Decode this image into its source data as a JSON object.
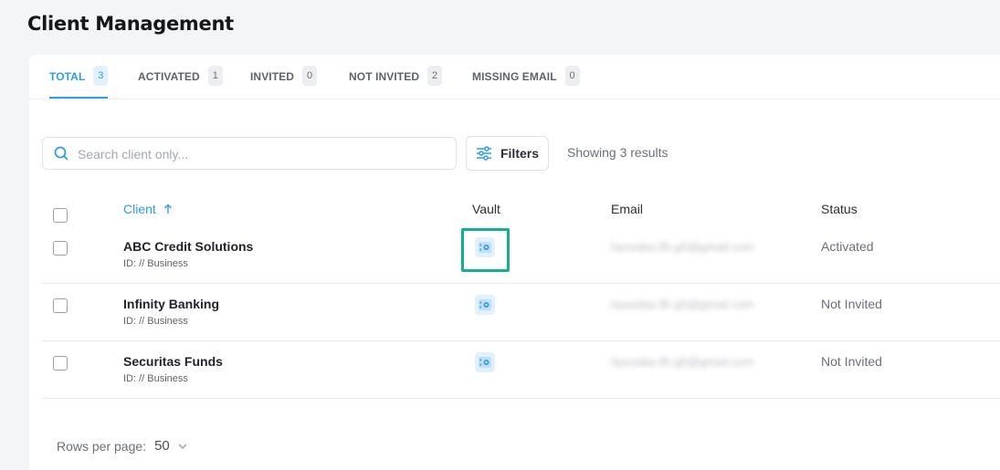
{
  "page": {
    "title": "Client Management"
  },
  "tabs": [
    {
      "label": "TOTAL",
      "count": "3"
    },
    {
      "label": "ACTIVATED",
      "count": "1"
    },
    {
      "label": "INVITED",
      "count": "0"
    },
    {
      "label": "NOT INVITED",
      "count": "2"
    },
    {
      "label": "MISSING EMAIL",
      "count": "0"
    }
  ],
  "toolbar": {
    "search_placeholder": "Search client only...",
    "search_value": "",
    "filters_label": "Filters",
    "results_text": "Showing 3 results"
  },
  "table": {
    "headers": {
      "client": "Client",
      "vault": "Vault",
      "email": "Email",
      "status": "Status"
    },
    "sort_icon": "arrow-up-icon",
    "rows": [
      {
        "name": "ABC Credit Solutions",
        "id": "ID: // Business",
        "email": "hpsodas.llh.g5@gmail.com",
        "status": "Activated"
      },
      {
        "name": "Infinity Banking",
        "id": "ID: // Business",
        "email": "hpsodas.llh.g5@gmail.com",
        "status": "Not Invited"
      },
      {
        "name": "Securitas Funds",
        "id": "ID: // Business",
        "email": "hpsodas.llh.g5@gmail.com",
        "status": "Not Invited"
      }
    ]
  },
  "pagination": {
    "rows_per_page_label": "Rows per page:",
    "rows_per_page_value": "50"
  },
  "colors": {
    "accent": "#2d9ee3",
    "highlight": "#14b08d"
  }
}
